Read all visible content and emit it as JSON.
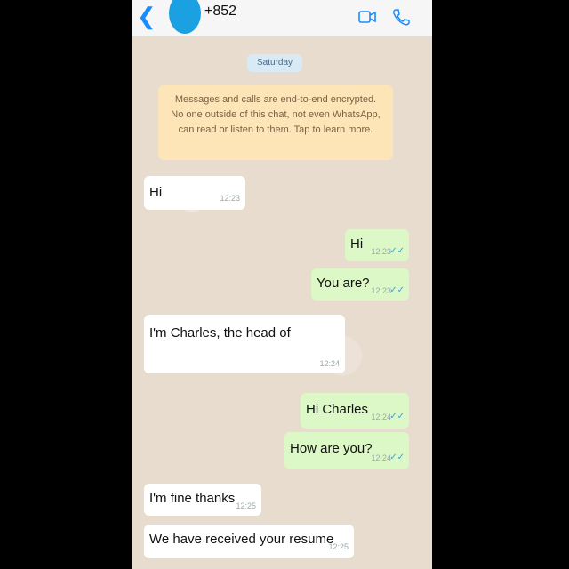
{
  "header": {
    "contact": "+852",
    "icons": [
      "back-icon",
      "video-call-icon",
      "phone-icon"
    ]
  },
  "chat": {
    "date_chip": "Saturday",
    "encryption_notice": "Messages and calls are end-to-end encrypted. No one outside of this chat, not even WhatsApp, can read or listen to them. Tap to learn more.",
    "messages": [
      {
        "dir": "in",
        "text": "Hi",
        "time": "12:23"
      },
      {
        "dir": "out",
        "text": "Hi",
        "time": "12:23"
      },
      {
        "dir": "out",
        "text": "You are?",
        "time": "12:23"
      },
      {
        "dir": "in",
        "text": "I'm Charles, the head of",
        "time": "12:24"
      },
      {
        "dir": "out",
        "text": "Hi Charles",
        "time": "12:24"
      },
      {
        "dir": "out",
        "text": "How are you?",
        "time": "12:24"
      },
      {
        "dir": "in",
        "text": "I'm fine thanks",
        "time": "12:25"
      },
      {
        "dir": "in",
        "text": "We have received your resume",
        "time": "12:25"
      }
    ]
  },
  "colors": {
    "incoming": "#ffffff",
    "outgoing": "#dcf8c6",
    "notice": "#fde5b8",
    "accent": "#1a8cff"
  }
}
